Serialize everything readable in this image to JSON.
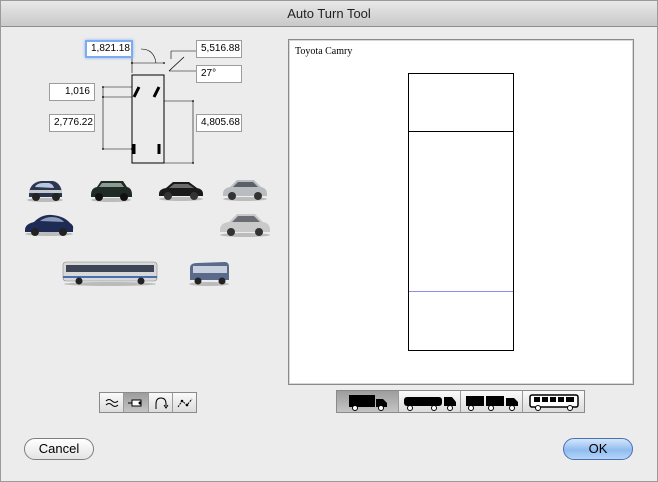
{
  "window": {
    "title": "Auto Turn Tool"
  },
  "dimensions": {
    "front_overhang": "1,821.18",
    "wheelbase_top": "5,516.88",
    "steer_angle": "27°",
    "track_width": "1,016",
    "rear_overhang": "2,776.22",
    "overall_length": "4,805.68"
  },
  "vehicle_palette": [
    {
      "icon": "smart-car-icon",
      "color": "#2a3550"
    },
    {
      "icon": "mini-cooper-icon",
      "color": "#1f2b24"
    },
    {
      "icon": "sedan-dark-icon",
      "color": "#1a1a1a"
    },
    {
      "icon": "mercedes-silver-icon",
      "color": "#b9bcc0"
    },
    {
      "icon": "porsche-blue-icon",
      "color": "#1e2c55"
    },
    {
      "icon": "lexus-silver-icon",
      "color": "#c9c9c9"
    },
    {
      "icon": "city-bus-icon",
      "color": "#d8d8d8"
    },
    {
      "icon": "coach-bus-icon",
      "color": "#5a6a8a"
    }
  ],
  "path_tools": [
    {
      "icon": "freehand-path-icon",
      "selected": false
    },
    {
      "icon": "follow-path-icon",
      "selected": true
    },
    {
      "icon": "arc-path-icon",
      "selected": false
    },
    {
      "icon": "polyline-path-icon",
      "selected": false
    }
  ],
  "preview": {
    "vehicle_name": "Toyota Camry"
  },
  "vehicle_types": [
    {
      "icon": "single-unit-truck-icon",
      "selected": true
    },
    {
      "icon": "tractor-trailer-icon",
      "selected": false
    },
    {
      "icon": "double-trailer-icon",
      "selected": false
    },
    {
      "icon": "bus-icon",
      "selected": false
    }
  ],
  "buttons": {
    "cancel": "Cancel",
    "ok": "OK"
  }
}
